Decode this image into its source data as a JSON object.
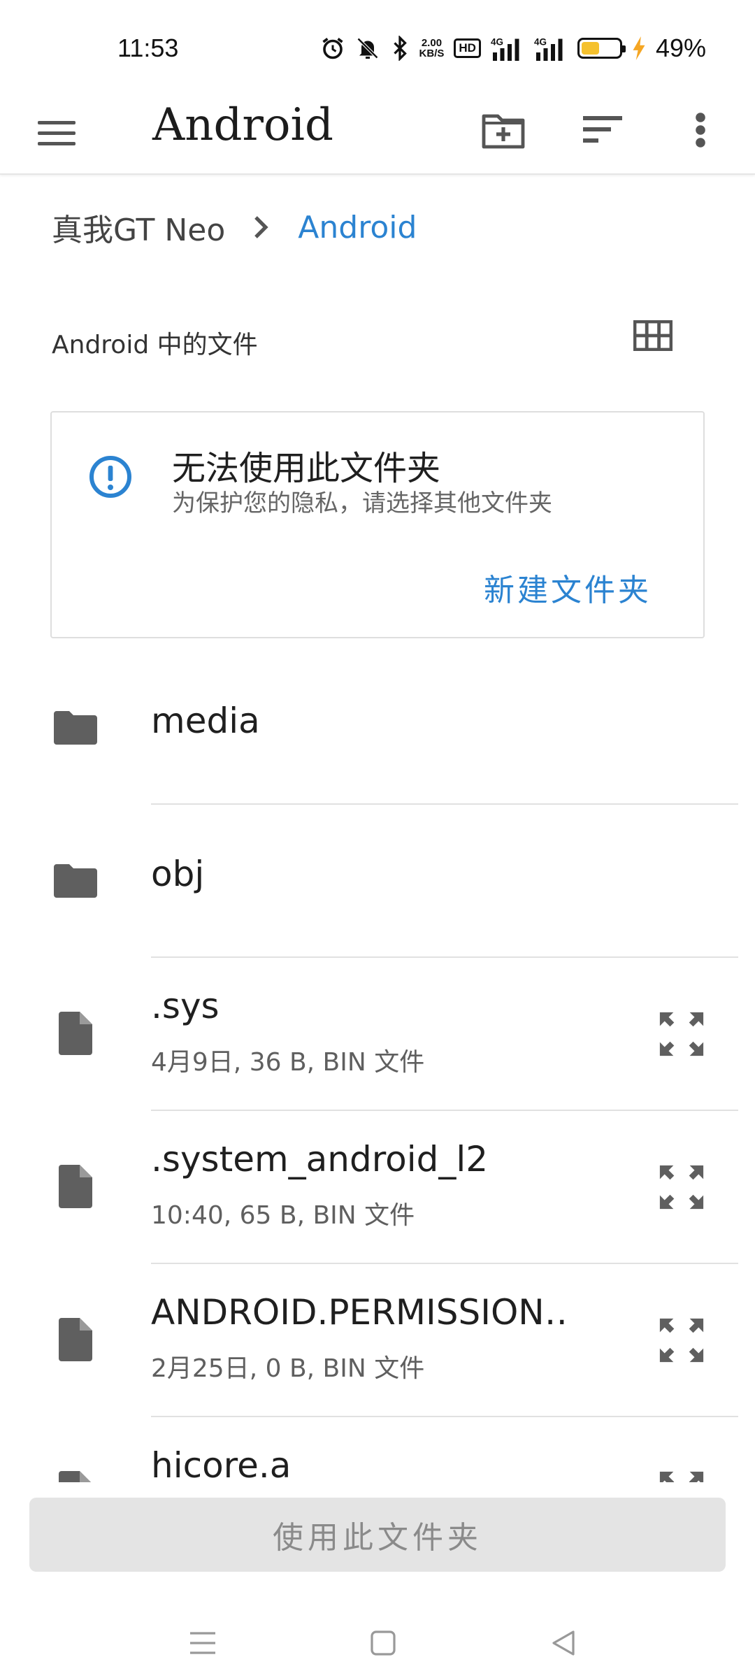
{
  "status_bar": {
    "time": "11:53",
    "network_speed_value": "2.00",
    "network_speed_unit": "KB/S",
    "hd_badge": "HD",
    "signal1_label": "4G",
    "signal2_label": "4G",
    "battery_percent": "49%",
    "battery_level": 0.49,
    "icons": [
      "alarm-icon",
      "mute-icon",
      "bluetooth-icon",
      "signal-icon",
      "signal-icon",
      "battery-icon",
      "charging-icon"
    ]
  },
  "toolbar": {
    "title": "Android",
    "icons": [
      "menu-icon",
      "new-folder-icon",
      "sort-icon",
      "more-vert-icon"
    ]
  },
  "breadcrumb": {
    "root": "真我GT Neo",
    "current": "Android"
  },
  "section": {
    "heading": "Android 中的文件"
  },
  "notice": {
    "title": "无法使用此文件夹",
    "subtitle": "为保护您的隐私，请选择其他文件夹",
    "action": "新建文件夹"
  },
  "files": [
    {
      "name": "media",
      "type": "folder",
      "meta": ""
    },
    {
      "name": "obj",
      "type": "folder",
      "meta": ""
    },
    {
      "name": ".sys",
      "type": "file",
      "meta": "4月9日, 36 B, BIN 文件"
    },
    {
      "name": ".system_android_l2",
      "type": "file",
      "meta": "10:40, 65 B, BIN 文件"
    },
    {
      "name": "ANDROID.PERMISSION…",
      "type": "file",
      "meta": "2月25日, 0 B, BIN 文件"
    },
    {
      "name": "hicore.a",
      "type": "file",
      "meta": ""
    }
  ],
  "bottom": {
    "use_folder_label": "使用此文件夹"
  },
  "colors": {
    "accent": "#2b83d1",
    "battery_fill": "#f5c12e",
    "charging": "#f5a623",
    "icon_gray": "#5f5f5f"
  }
}
